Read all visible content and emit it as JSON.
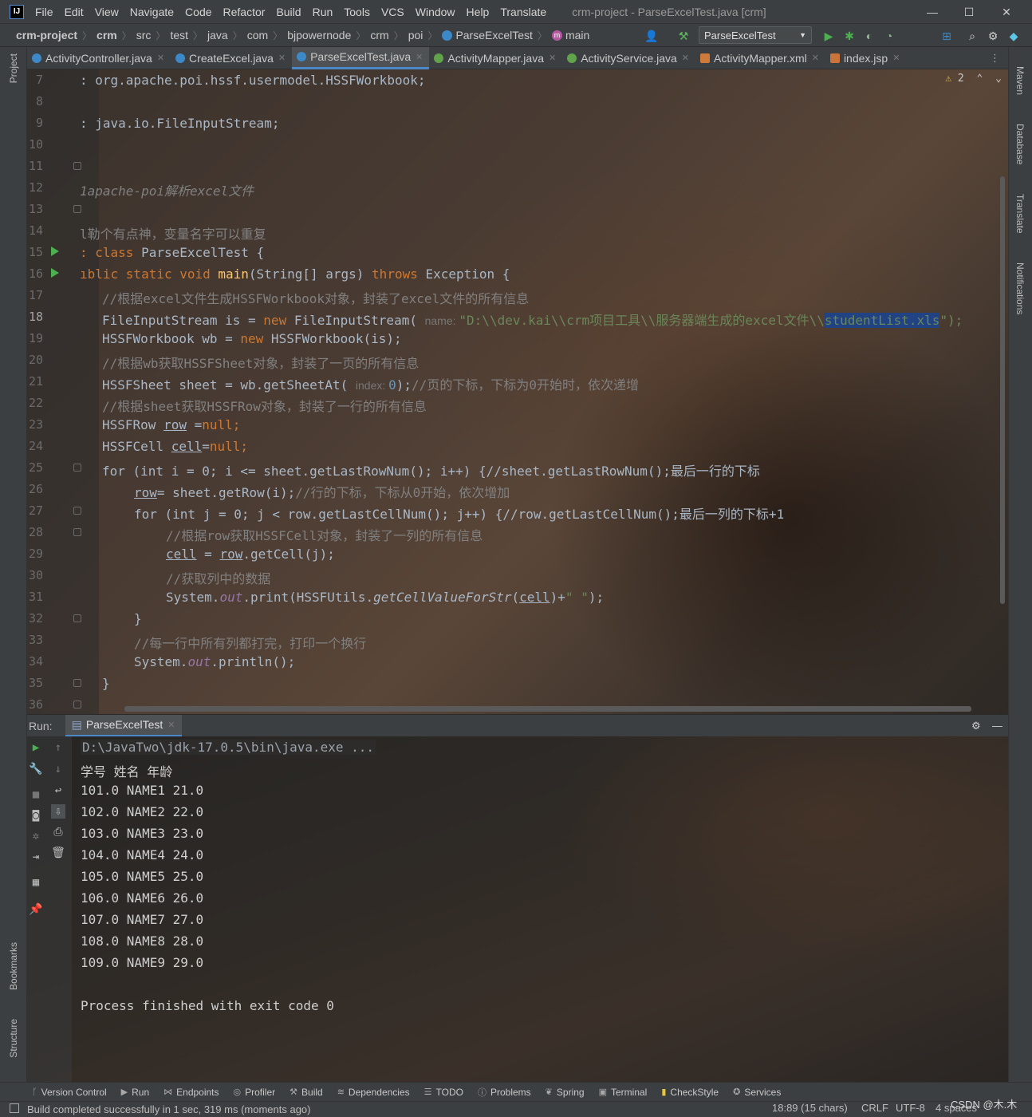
{
  "window": {
    "logo": "IJ",
    "menu": [
      "File",
      "Edit",
      "View",
      "Navigate",
      "Code",
      "Refactor",
      "Build",
      "Run",
      "Tools",
      "VCS",
      "Window",
      "Help",
      "Translate"
    ],
    "title": "crm-project - ParseExcelTest.java [crm]",
    "controls": {
      "minimize": "—",
      "maximize": "☐",
      "close": "✕"
    }
  },
  "breadcrumbs": [
    "crm-project",
    "crm",
    "src",
    "test",
    "java",
    "com",
    "bjpowernode",
    "crm",
    "poi",
    "ParseExcelTest",
    "main"
  ],
  "toolbar": {
    "run_config": "ParseExcelTest"
  },
  "tabs": [
    {
      "label": "ActivityController.java",
      "color": "#3d88c6"
    },
    {
      "label": "CreateExcel.java",
      "color": "#3d88c6"
    },
    {
      "label": "ParseExcelTest.java",
      "color": "#3d88c6",
      "active": true
    },
    {
      "label": "ActivityMapper.java",
      "color": "#61a34a"
    },
    {
      "label": "ActivityService.java",
      "color": "#61a34a"
    },
    {
      "label": "ActivityMapper.xml",
      "color": "#d07a3a"
    },
    {
      "label": "index.jsp",
      "color": "#c9743b"
    }
  ],
  "left_stripe": {
    "project": "Project",
    "bookmarks": "Bookmarks",
    "structure": "Structure"
  },
  "right_stripe": {
    "maven": "Maven",
    "database": "Database",
    "translate": "Translate",
    "notifications": "Notifications"
  },
  "editor": {
    "warning_count": "2",
    "line_numbers": [
      "7",
      "8",
      "9",
      "10",
      "11",
      "12",
      "13",
      "14",
      "15",
      "16",
      "17",
      "18",
      "19",
      "20",
      "21",
      "22",
      "23",
      "24",
      "25",
      "26",
      "27",
      "28",
      "29",
      "30",
      "31",
      "32",
      "33",
      "34",
      "35",
      "36"
    ],
    "current_line": "18",
    "lines": {
      "l7": ": org.apache.poi.hssf.usermodel.HSSFWorkbook;",
      "l9": ": java.io.FileInputStream;",
      "l12": "1apache-poi解析excel文件",
      "l14": "l勒个有点神，变量名字可以重复",
      "l15_kw": ": class ",
      "l15_rest": "ParseExcelTest {",
      "l16_a": "ıblic static void ",
      "l16_fn": "main",
      "l16_b": "(String[] args) ",
      "l16_kw": "throws",
      "l16_c": " Exception {",
      "l17": "//根据excel文件生成HSSFWorkbook对象，封装了excel文件的所有信息",
      "l18_a": "FileInputStream is = ",
      "l18_kw": "new",
      "l18_b": " FileInputStream( ",
      "l18_hint": "name: ",
      "l18_str": "\"D:\\\\dev.kai\\\\crm项目工具\\\\服务器端生成的excel文件\\\\",
      "l18_sel": "studentList.xls",
      "l18_end": "\");",
      "l19_a": "HSSFWorkbook wb = ",
      "l19_kw": "new",
      "l19_b": " HSSFWorkbook(is);",
      "l20": "//根据wb获取HSSFSheet对象，封装了一页的所有信息",
      "l21_a": "HSSFSheet sheet = wb.getSheetAt( ",
      "l21_hint": "index: ",
      "l21_num": "0",
      "l21_b": ");",
      "l21_cmt": "//页的下标，下标为0开始时，依次递增",
      "l22": "//根据sheet获取HSSFRow对象，封装了一行的所有信息",
      "l23_a": "HSSFRow ",
      "l23_var": "row",
      "l23_b": " =",
      "l23_kw": "null",
      "l23_c": ";",
      "l24_a": "HSSFCell ",
      "l24_var": "cell",
      "l24_b": "=",
      "l24_kw": "null",
      "l24_c": ";",
      "l25": "for (int i = 0; i <= sheet.getLastRowNum(); i++) {//sheet.getLastRowNum();最后一行的下标",
      "l26_var": "row",
      "l26_a": "= sheet.getRow(i);",
      "l26_cmt": "//行的下标，下标从0开始，依次增加",
      "l27": "for (int j = 0; j < row.getLastCellNum(); j++) {//row.getLastCellNum();最后一列的下标+1",
      "l28": "//根据row获取HSSFCell对象，封装了一列的所有信息",
      "l29_var": "cell",
      "l29_a": " = ",
      "l29_var2": "row",
      "l29_b": ".getCell(j);",
      "l30": "//获取列中的数据",
      "l31_a": "System.",
      "l31_fld": "out",
      "l31_b": ".print(HSSFUtils.",
      "l31_stat": "getCellValueForStr",
      "l31_c": "(",
      "l31_var": "cell",
      "l31_d": ")+",
      "l31_str": "\" \"",
      "l31_e": ");",
      "l32": "}",
      "l33": "//每一行中所有列都打完，打印一个换行",
      "l34_a": "System.",
      "l34_fld": "out",
      "l34_b": ".println();",
      "l35": "}"
    }
  },
  "run": {
    "label": "Run:",
    "tab": "ParseExcelTest",
    "output": [
      "D:\\JavaTwo\\jdk-17.0.5\\bin\\java.exe ...",
      "学号 姓名 年龄",
      "101.0 NAME1 21.0",
      "102.0 NAME2 22.0",
      "103.0 NAME3 23.0",
      "104.0 NAME4 24.0",
      "105.0 NAME5 25.0",
      "106.0 NAME6 26.0",
      "107.0 NAME7 27.0",
      "108.0 NAME8 28.0",
      "109.0 NAME9 29.0",
      "",
      "Process finished with exit code 0"
    ]
  },
  "bottom_tools": [
    "Version Control",
    "Run",
    "Endpoints",
    "Profiler",
    "Build",
    "Dependencies",
    "TODO",
    "Problems",
    "Spring",
    "Terminal",
    "CheckStyle",
    "Services"
  ],
  "status": {
    "message": "Build completed successfully in 1 sec, 319 ms (moments ago)",
    "position": "18:89 (15 chars)",
    "line_sep": "CRLF",
    "encoding": "UTF-8",
    "indent": "4 spaces",
    "watermark": "CSDN @木.木"
  }
}
